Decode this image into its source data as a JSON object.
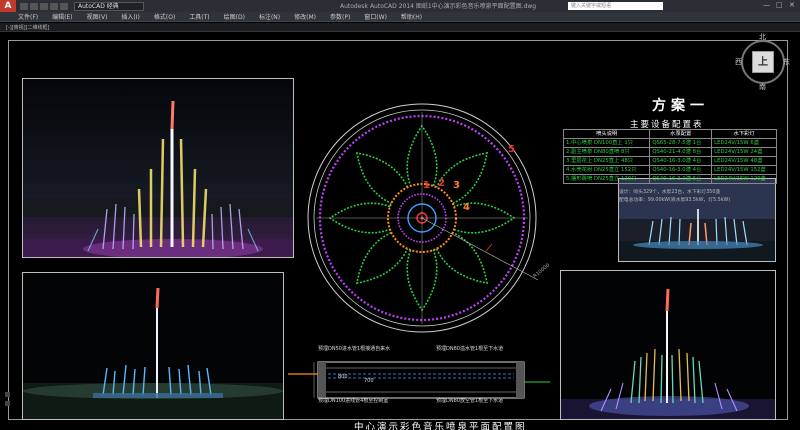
{
  "app": {
    "logo": "A",
    "workspace": "AutoCAD 经典",
    "window_title": "Autodesk AutoCAD 2014   图纸1中心演示彩色音乐喷泉平面配置图.dwg",
    "search_placeholder": "键入关键字或短语",
    "win_buttons": [
      "—",
      "□",
      "✕"
    ]
  },
  "menu": [
    "文件(F)",
    "编辑(E)",
    "视图(V)",
    "插入(I)",
    "格式(O)",
    "工具(T)",
    "绘图(D)",
    "标注(N)",
    "修改(M)",
    "参数(P)",
    "窗口(W)",
    "帮助(H)"
  ],
  "doc_tab": "[-][俯视][二维线框]",
  "viewcube": {
    "top": "上",
    "north": "北",
    "south": "南",
    "west": "西",
    "east": "东"
  },
  "plan": {
    "title": "方案一",
    "table_title": "主要设备配置表",
    "headers": [
      "喷头说明",
      "水泵配置",
      "水下彩灯"
    ],
    "rows": [
      [
        "1.中心喷泉   DN100直上  1只",
        "QS65-28-7.5潜  1台",
        "LED24V/15W    6盏"
      ],
      [
        "2.副主喷泉   DN80直喷    8只",
        "QS40-21-4.0潜  8台",
        "LED24V/15W   24盏"
      ],
      [
        "3.里层花上   DN25直上  48只",
        "QS40-16-3.0潜  4台",
        "LED24V/15W   48盏"
      ],
      [
        "4.水壳花射   DN25直立  152只",
        "QS40-16-3.0潜  4台",
        "LED24V/15W  152盏"
      ],
      [
        "5.摆形跳喷   DN25直立  120只",
        "QS40-16-3.0潜  6台",
        "LED24V/15W  120盏"
      ]
    ],
    "notes": [
      "设计：喷头329个，水泵23台，水下彩灯350盏",
      "配电总功率：99.00kW(喷水泵93.5kW，灯5.5kW)"
    ]
  },
  "drawing": {
    "ring_labels": [
      "1",
      "2",
      "3",
      "4",
      "5"
    ],
    "dimension": "R10000",
    "detail_labels": {
      "top_left": "预埋DN50进水管1根接通自来水",
      "top_right": "预埋DN80溢水管1根至下水道",
      "bottom_left": "预埋DN100进线管4根至控制室",
      "bottom_right": "预埋DN80放空管1根至下水道",
      "dim1": "800",
      "dim2": "700"
    },
    "caption": "中心演示彩色音乐喷泉平面配置图"
  },
  "colors": {
    "green": "#2ecc40",
    "magenta": "#c040ff",
    "orange": "#ff8c1a",
    "red": "#e53935",
    "blue": "#3aa0ff"
  }
}
